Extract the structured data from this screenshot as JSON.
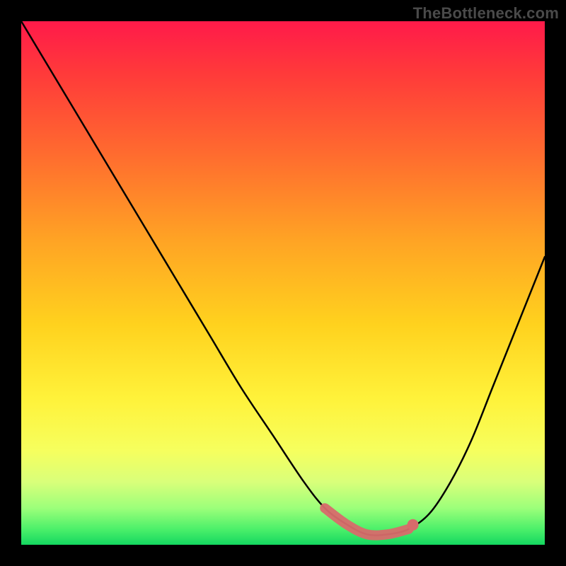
{
  "watermark": "TheBottleneck.com",
  "chart_data": {
    "type": "line",
    "title": "",
    "xlabel": "",
    "ylabel": "",
    "xlim": [
      0,
      100
    ],
    "ylim": [
      0,
      100
    ],
    "series": [
      {
        "name": "bottleneck-curve",
        "x": [
          0,
          6,
          12,
          18,
          24,
          30,
          36,
          42,
          48,
          54,
          58,
          62,
          66,
          70,
          74,
          78,
          82,
          86,
          90,
          94,
          98,
          100
        ],
        "values": [
          100,
          90,
          80,
          70,
          60,
          50,
          40,
          30,
          21,
          12,
          7,
          4,
          2,
          2,
          3,
          6,
          12,
          20,
          30,
          40,
          50,
          55
        ]
      }
    ],
    "annotations": {
      "valley_marker": {
        "x_start": 55,
        "x_end": 76,
        "style": "pink-dots"
      }
    },
    "background": "heat-gradient-vertical"
  },
  "colors": {
    "curve": "#000000",
    "marker": "#d86b6b",
    "frame": "#000000"
  }
}
